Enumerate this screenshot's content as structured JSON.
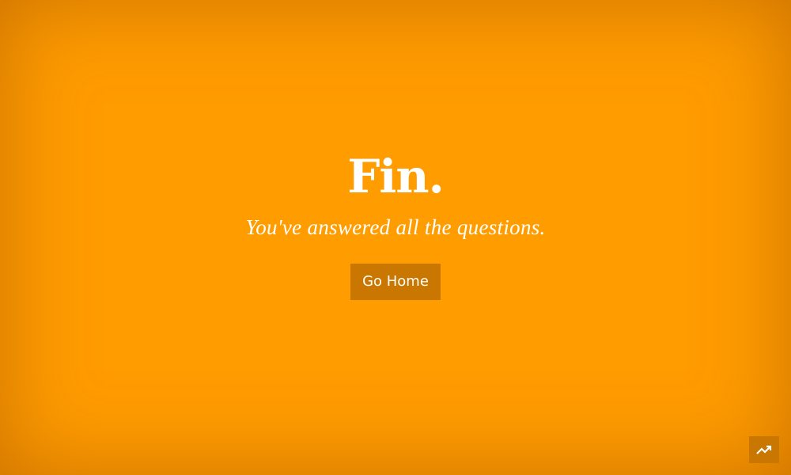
{
  "main": {
    "title": "Fin.",
    "subtitle": "You've answered all the questions.",
    "go_home_label": "Go Home"
  },
  "corner_button": {
    "icon": "trending-up-icon"
  },
  "colors": {
    "background": "#ff9c00",
    "button": "#c97700",
    "text": "#ffffff"
  }
}
